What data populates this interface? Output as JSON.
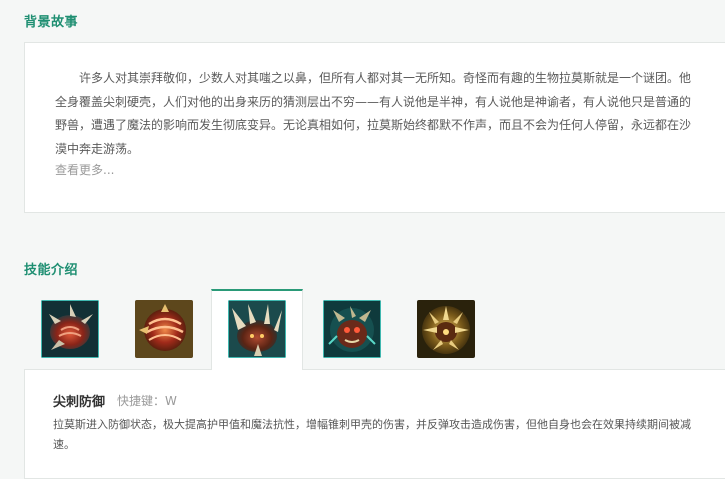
{
  "story": {
    "title": "背景故事",
    "text": "许多人对其崇拜敬仰，少数人对其嗤之以鼻，但所有人都对其一无所知。奇怪而有趣的生物拉莫斯就是一个谜团。他全身覆盖尖刺硬壳，人们对他的出身来历的猜测层出不穷——有人说他是半神，有人说他是神谕者，有人说他只是普通的野兽，遭遇了魔法的影响而发生彻底变异。无论真相如何，拉莫斯始终都默不作声，而且不会为任何人停留，永远都在沙漠中奔走游荡。",
    "more_label": "查看更多..."
  },
  "skills": {
    "title": "技能介绍",
    "tabs": [
      {
        "icon": "passive-spiked-shell-icon",
        "accent": "#3fb8b0"
      },
      {
        "icon": "powerball-icon",
        "accent": "#c8a040"
      },
      {
        "icon": "defensive-ball-curl-icon",
        "accent": "#3fb8b0"
      },
      {
        "icon": "puncturing-taunt-icon",
        "accent": "#3fb8b0"
      },
      {
        "icon": "soaring-slam-icon",
        "accent": "#c8a040"
      }
    ],
    "active_index": 2,
    "detail": {
      "name": "尖刺防御",
      "hotkey": "快捷键：W",
      "description": "拉莫斯进入防御状态，极大提高护甲值和魔法抗性，增幅锥刺甲壳的伤害，并反弹攻击造成伤害，但他自身也会在效果持续期间被减速。"
    }
  },
  "colors": {
    "accent": "#1f8f72",
    "tab_active_border": "#2a9a78",
    "background": "#f5f7f6"
  }
}
